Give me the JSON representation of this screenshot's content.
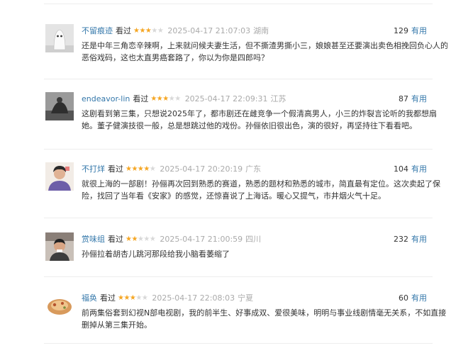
{
  "reviews": [
    {
      "user": "不留痕迹",
      "status": "看过",
      "rating": 3,
      "time": "2025-04-17 21:07:03",
      "location": "湖南",
      "votes": "129",
      "vote_label": "有用",
      "lines": [
        "还是中年三角恋辛辣啊，上来就问候夫妻生活，但不撕渣男撕小三，娘娘甚至还要演出卖色相挽回负心人的",
        "恶俗戏码，这也太直男癌套路了，你以为你是四郎吗？"
      ],
      "avatar_icon": "ghost-figure-avatar"
    },
    {
      "user": "endeavor-lin",
      "status": "看过",
      "rating": 3,
      "time": "2025-04-17 22:09:31",
      "location": "江苏",
      "votes": "87",
      "vote_label": "有用",
      "lines": [
        "这剧看到第三集，只想说2025年了，都市剧还在雌竞争一个假清高男人，小三的炸裂言论听的我都想扇",
        "她。董子健演技很一般，总是想跳过他的戏份。孙俪依旧很出色，演的很好，再坚持往下看看吧。"
      ],
      "avatar_icon": "dark-photo-avatar"
    },
    {
      "user": "不打烊",
      "status": "看过",
      "rating": 4,
      "time": "2025-04-17 20:20:19",
      "location": "广东",
      "votes": "104",
      "vote_label": "有用",
      "lines": [
        "就很上海的一部剧！孙俪再次回到熟悉的赛道，熟悉的题材和熟悉的城市，简直最有定位。这次卖起了保",
        "险，找回了当年看《安家》的感觉，还惊喜说了上海话。暖心又提气，市井烟火气十足。"
      ],
      "avatar_icon": "person-photo-avatar"
    },
    {
      "user": "赏味组",
      "status": "看过",
      "rating": 2,
      "time": "2025-04-17 21:00:59",
      "location": "四川",
      "votes": "232",
      "vote_label": "有用",
      "lines": [
        "孙俪拉着胡杏儿跳河那段给我小脑看萎缩了"
      ],
      "avatar_icon": "person-photo-avatar"
    },
    {
      "user": "福奂",
      "status": "看过",
      "rating": 3,
      "time": "2025-04-17 22:08:03",
      "location": "宁夏",
      "votes": "60",
      "vote_label": "有用",
      "lines": [
        "前两集俗套到幻视N部电视剧，我的前半生、好事成双、爱很美味，明明与事业线剧情毫无关系，不如直接",
        "删掉从第三集开始。"
      ],
      "avatar_icon": "food-photo-avatar"
    }
  ]
}
